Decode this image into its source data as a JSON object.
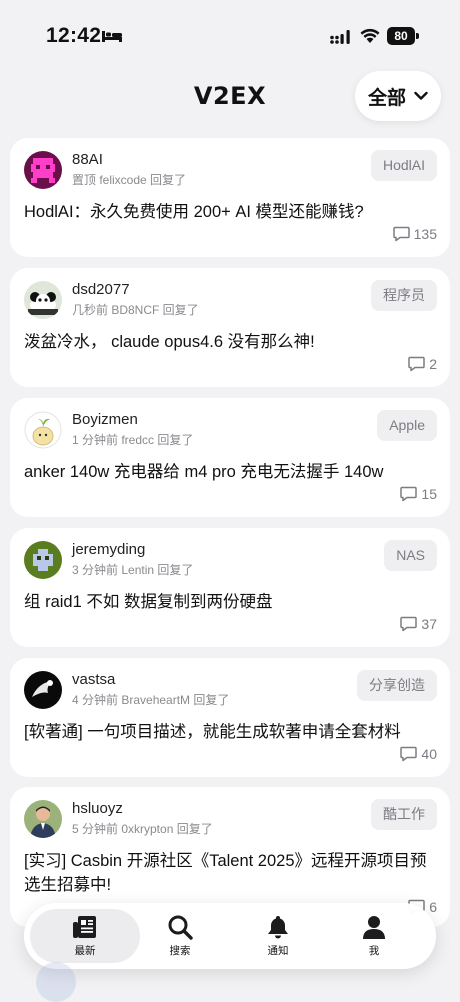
{
  "status_bar": {
    "time": "12:42",
    "battery": "80"
  },
  "header": {
    "title": "V2EX",
    "filter_label": "全部"
  },
  "posts": [
    {
      "username": "88AI",
      "meta": "置顶 felixcode 回复了",
      "node": "HodlAI",
      "title": "HodlAI：永久免费使用 200+ AI 模型还能赚钱?",
      "replies": "135"
    },
    {
      "username": "dsd2077",
      "meta": "几秒前 BD8NCF 回复了",
      "node": "程序员",
      "title": "泼盆冷水， claude opus4.6 没有那么神!",
      "replies": "2"
    },
    {
      "username": "Boyizmen",
      "meta": "1 分钟前 fredcc 回复了",
      "node": "Apple",
      "title": "anker 140w 充电器给 m4 pro 充电无法握手 140w",
      "replies": "15"
    },
    {
      "username": "jeremyding",
      "meta": "3 分钟前 Lentin 回复了",
      "node": "NAS",
      "title": "组 raid1 不如 数据复制到两份硬盘",
      "replies": "37"
    },
    {
      "username": "vastsa",
      "meta": "4 分钟前 BraveheartM 回复了",
      "node": "分享创造",
      "title": "[软著通] 一句项目描述，就能生成软著申请全套材料",
      "replies": "40"
    },
    {
      "username": "hsluoyz",
      "meta": "5 分钟前 0xkrypton 回复了",
      "node": "酷工作",
      "title": "[实习] Casbin 开源社区《Talent 2025》远程开源项目预选生招募中!",
      "replies": "6"
    }
  ],
  "tabbar": {
    "latest": "最新",
    "search": "搜索",
    "notifications": "通知",
    "me": "我"
  }
}
